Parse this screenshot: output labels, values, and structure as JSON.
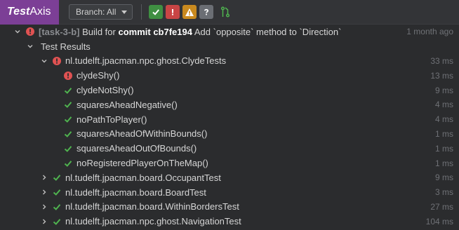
{
  "app": {
    "logo_bold": "Test",
    "logo_rest": "Axis"
  },
  "toolbar": {
    "branch_label": "Branch: All",
    "filters": [
      "pass-filter",
      "fail-filter",
      "warning-filter",
      "unknown-filter"
    ]
  },
  "build": {
    "task": "[task-3-b]",
    "text_pre": "Build for",
    "commit_word": "commit",
    "commit_hash": "cb7fe194",
    "message": "Add `opposite` method to `Direction`",
    "time": "1 month ago"
  },
  "results_label": "Test Results",
  "suites": [
    {
      "name": "nl.tudelft.jpacman.npc.ghost.ClydeTests",
      "time": "33 ms",
      "status": "fail",
      "tests": [
        {
          "name": "clydeShy()",
          "time": "13 ms",
          "status": "fail"
        },
        {
          "name": "clydeNotShy()",
          "time": "9 ms",
          "status": "pass"
        },
        {
          "name": "squaresAheadNegative()",
          "time": "4 ms",
          "status": "pass"
        },
        {
          "name": "noPathToPlayer()",
          "time": "4 ms",
          "status": "pass"
        },
        {
          "name": "squaresAheadOfWithinBounds()",
          "time": "1 ms",
          "status": "pass"
        },
        {
          "name": "squaresAheadOutOfBounds()",
          "time": "1 ms",
          "status": "pass"
        },
        {
          "name": "noRegisteredPlayerOnTheMap()",
          "time": "1 ms",
          "status": "pass"
        }
      ]
    },
    {
      "name": "nl.tudelft.jpacman.board.OccupantTest",
      "time": "9 ms",
      "status": "pass"
    },
    {
      "name": "nl.tudelft.jpacman.board.BoardTest",
      "time": "3 ms",
      "status": "pass"
    },
    {
      "name": "nl.tudelft.jpacman.board.WithinBordersTest",
      "time": "27 ms",
      "status": "pass"
    },
    {
      "name": "nl.tudelft.jpacman.npc.ghost.NavigationTest",
      "time": "104 ms",
      "status": "pass"
    }
  ],
  "colors": {
    "pass": "#4fb34f",
    "fail": "#e05252",
    "brand": "#7c3f96"
  }
}
